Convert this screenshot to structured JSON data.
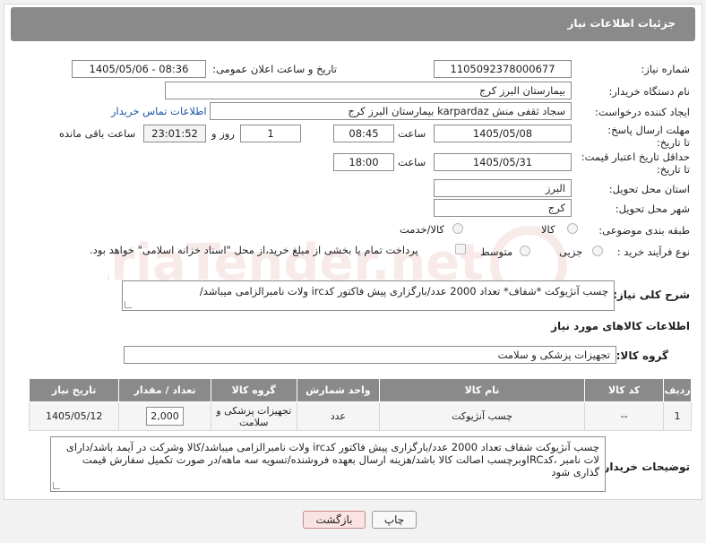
{
  "header": {
    "title": "جزئیات اطلاعات نیاز"
  },
  "form": {
    "need_number_label": "شماره نیاز:",
    "need_number": "1105092378000677",
    "announce_label": "تاریخ و ساعت اعلان عمومی:",
    "announce_value": "1405/05/06 - 08:36",
    "buyer_org_label": "نام دستگاه خریدار:",
    "buyer_org": "بیمارستان البرز کرج",
    "creator_label": "ایجاد کننده درخواست:",
    "creator": "سجاد ثقفی منش karpardaz بیمارستان البرز کرج",
    "contact_link": "اطلاعات تماس خریدار",
    "reply_deadline_label": "مهلت ارسال پاسخ: تا تاریخ:",
    "reply_date": "1405/05/08",
    "time_label": "ساعت",
    "reply_time": "08:45",
    "days_count": "1",
    "days_label": "روز و",
    "remaining_time": "23:01:52",
    "remaining_label": "ساعت باقی مانده",
    "price_validity_label": "حداقل تاریخ اعتبار قیمت: تا تاریخ:",
    "price_date": "1405/05/31",
    "price_time_label": "ساعت",
    "price_time": "18:00",
    "province_label": "استان محل تحویل:",
    "province": "البرز",
    "city_label": "شهر محل تحویل:",
    "city": "کرج",
    "category_label": "طبقه بندی موضوعی:",
    "category_options": [
      "کالا",
      "کالا/خدمت"
    ],
    "process_label": "نوع فرآیند خرید :",
    "process_options": [
      "جزیی",
      "متوسط"
    ],
    "payment_note": "پرداخت تمام یا بخشی از مبلغ خرید،از محل \"اسناد خزانه اسلامی\" خواهد بود."
  },
  "description": {
    "label": "شرح کلی نیاز:",
    "text": "چسب آنژیوکت *شفاف* تعداد 2000 عدد/بارگزاری پیش فاکتور کدirc ولات نامبرالزامی میباشد/"
  },
  "goods": {
    "section_title": "اطلاعات کالاهای مورد نیاز",
    "group_label": "گروه کالا:",
    "group_value": "تجهیزات پزشکی و سلامت",
    "columns": [
      "ردیف",
      "کد کالا",
      "نام کالا",
      "واحد شمارش",
      "گروه کالا",
      "تعداد / مقدار",
      "تاریخ نیاز"
    ],
    "rows": [
      [
        "1",
        "--",
        "چسب آنژیوکت",
        "عدد",
        "تجهیزات پزشکی و سلامت",
        "2,000",
        "1405/05/12"
      ]
    ]
  },
  "buyer_notes": {
    "label": "توضیحات خریدار:",
    "text": "چسب آنژیوکت شفاف تعداد 2000 عدد/بارگزاری پیش فاکتور کدirc ولات نامبرالزامی میباشد/کالا وشرکت در آیمد باشد/دارای لات نامبر ،کدIRCوبرچسب اصالت کالا باشد/هزینه ارسال بعهده فروشنده/تسویه سه ماهه/در صورت تکمیل سفارش قیمت گذاری شود"
  },
  "buttons": {
    "print": "چاپ",
    "back": "بازگشت"
  },
  "watermark": {
    "text": "AriaTender.net"
  },
  "colors": {
    "header_bg": "#8a8a8a",
    "link": "#1a55a8",
    "back_btn_bg": "#fbe3e3"
  }
}
